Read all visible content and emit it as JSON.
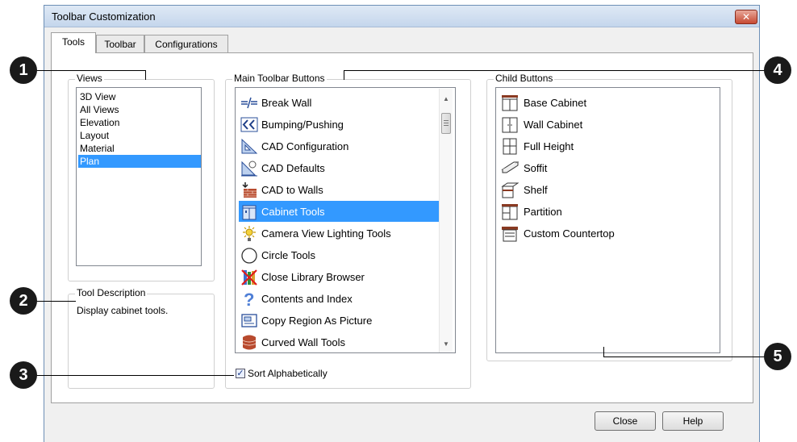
{
  "window": {
    "title": "Toolbar Customization",
    "close_glyph": "✕"
  },
  "tabs": [
    {
      "label": "Tools",
      "active": true
    },
    {
      "label": "Toolbar",
      "active": false
    },
    {
      "label": "Configurations",
      "active": false
    }
  ],
  "views": {
    "label": "Views",
    "items": [
      "3D View",
      "All Views",
      "Elevation",
      "Layout",
      "Material",
      "Plan"
    ],
    "selected": "Plan"
  },
  "tool_description": {
    "label": "Tool Description",
    "text": "Display cabinet tools."
  },
  "main_toolbar": {
    "label": "Main Toolbar Buttons",
    "items": [
      {
        "label": "Break Wall",
        "icon": "break-wall-icon"
      },
      {
        "label": "Bumping/Pushing",
        "icon": "bumping-pushing-icon"
      },
      {
        "label": "CAD Configuration",
        "icon": "cad-configuration-icon"
      },
      {
        "label": "CAD Defaults",
        "icon": "cad-defaults-icon"
      },
      {
        "label": "CAD to Walls",
        "icon": "cad-to-walls-icon"
      },
      {
        "label": "Cabinet Tools",
        "icon": "cabinet-tools-icon"
      },
      {
        "label": "Camera View Lighting Tools",
        "icon": "camera-lighting-icon"
      },
      {
        "label": "Circle Tools",
        "icon": "circle-tools-icon"
      },
      {
        "label": "Close Library Browser",
        "icon": "close-library-icon"
      },
      {
        "label": "Contents and Index",
        "icon": "help-question-icon"
      },
      {
        "label": "Copy Region As Picture",
        "icon": "copy-region-icon"
      },
      {
        "label": "Curved Wall Tools",
        "icon": "curved-wall-icon"
      }
    ],
    "selected": "Cabinet Tools",
    "scroll_up": "▲",
    "scroll_down": "▼"
  },
  "sort": {
    "label": "Sort Alphabetically",
    "checked": true,
    "mark": "✓"
  },
  "child_buttons": {
    "label": "Child Buttons",
    "items": [
      {
        "label": "Base Cabinet",
        "icon": "base-cabinet-icon"
      },
      {
        "label": "Wall Cabinet",
        "icon": "wall-cabinet-icon"
      },
      {
        "label": "Full Height",
        "icon": "full-height-cabinet-icon"
      },
      {
        "label": "Soffit",
        "icon": "soffit-icon"
      },
      {
        "label": "Shelf",
        "icon": "shelf-icon"
      },
      {
        "label": "Partition",
        "icon": "partition-icon"
      },
      {
        "label": "Custom Countertop",
        "icon": "countertop-icon"
      }
    ]
  },
  "buttons": {
    "close": "Close",
    "help": "Help"
  },
  "callouts": [
    "1",
    "2",
    "3",
    "4",
    "5"
  ],
  "colors": {
    "selection": "#3399ff",
    "callout": "#1a1a1a"
  }
}
